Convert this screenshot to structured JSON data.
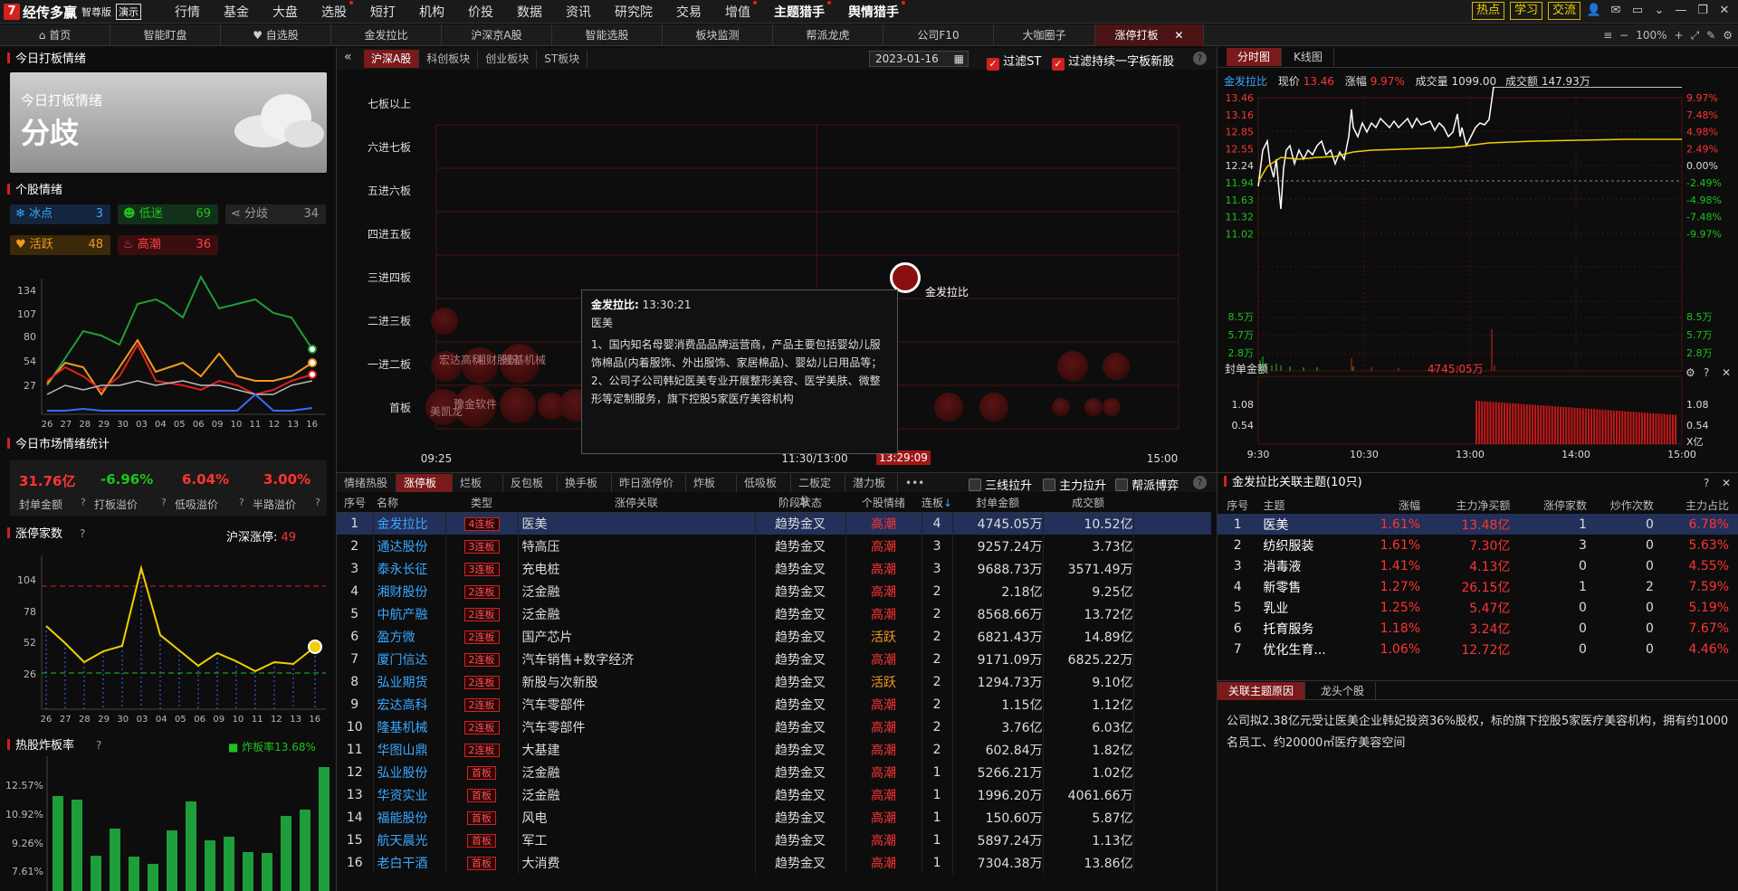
{
  "app": {
    "name": "经传多赢",
    "edition": "智尊版",
    "demo": "演示",
    "menus": [
      "行情",
      "基金",
      "大盘",
      "选股",
      "短打",
      "机构",
      "价投",
      "数据",
      "资讯",
      "研究院",
      "交易",
      "增值",
      "主题猎手",
      "舆情猎手"
    ],
    "right_tags": [
      "热点",
      "学习",
      "交流"
    ],
    "zoom": "100%"
  },
  "tabs": [
    "首页",
    "智能盯盘",
    "自选股",
    "金发拉比",
    "沪深京A股",
    "智能选股",
    "板块监测",
    "帮派龙虎",
    "公司F10",
    "大咖圈子",
    "涨停打板"
  ],
  "left": {
    "title": "今日打板情绪",
    "card_title": "今日打板情绪",
    "card_value": "分歧",
    "mood_title": "个股情绪",
    "moods": [
      {
        "label": "冰点",
        "value": "3"
      },
      {
        "label": "低迷",
        "value": "69"
      },
      {
        "label": "分歧",
        "value": "34"
      },
      {
        "label": "活跃",
        "value": "48"
      },
      {
        "label": "高潮",
        "value": "36"
      }
    ],
    "mood_chart": {
      "yticks": [
        "134",
        "107",
        "80",
        "54",
        "27"
      ],
      "xticks": [
        "26",
        "27",
        "28",
        "29",
        "30",
        "03",
        "04",
        "05",
        "06",
        "09",
        "10",
        "11",
        "12",
        "13",
        "16"
      ]
    },
    "stats_title": "今日市场情绪统计",
    "stats": [
      {
        "value": "31.76亿",
        "label": "封单金额"
      },
      {
        "value": "-6.96%",
        "label": "打板溢价"
      },
      {
        "value": "6.04%",
        "label": "低吸溢价"
      },
      {
        "value": "3.00%",
        "label": "半路溢价"
      }
    ],
    "limit_title": "涨停家数",
    "limit_label": "沪深涨停:",
    "limit_value": "49",
    "limit_chart": {
      "yticks": [
        "104",
        "78",
        "52",
        "26"
      ],
      "xticks": [
        "26",
        "27",
        "28",
        "29",
        "30",
        "03",
        "04",
        "05",
        "06",
        "09",
        "10",
        "11",
        "12",
        "13",
        "16"
      ]
    },
    "burst_title": "热股炸板率",
    "burst_label": "炸板率13.68%",
    "burst_yticks": [
      "12.57%",
      "10.92%",
      "9.26%",
      "7.61%"
    ]
  },
  "mid": {
    "markets": [
      "沪深A股",
      "科创板块",
      "创业板块",
      "ST板块"
    ],
    "date": "2023-01-16",
    "filter1": "过滤ST",
    "filter2": "过滤持续一字板新股",
    "levels": [
      "七板以上",
      "六进七板",
      "五进六板",
      "四进五板",
      "三进四板",
      "二进三板",
      "一进二板",
      "首板"
    ],
    "times": [
      "09:25",
      "11:30/13:00",
      "13:29:09",
      "15:00"
    ],
    "bubble_label": "金发拉比",
    "bubble_texts": [
      "宏达高科",
      "湘财股份",
      "隆基机械",
      "美凯龙",
      "豫金软件"
    ],
    "tooltip": {
      "name": "金发拉比:",
      "time": "13:30:21",
      "theme": "医美",
      "line1": "1、国内知名母婴消费品品牌运营商，产品主要包括婴幼儿服饰棉品(内着服饰、外出服饰、家居棉品)、婴幼儿日用品等；",
      "line2": "2、公司子公司韩妃医美专业开展整形美容、医学美肤、微整形等定制服务，旗下控股5家医疗美容机构"
    },
    "subtabs": [
      "情绪热股",
      "涨停板",
      "烂板",
      "反包板",
      "换手板",
      "昨日涨停价",
      "炸板",
      "低吸板",
      "二板定龙",
      "潜力板"
    ],
    "opt1": "三线拉升",
    "opt2": "主力拉升",
    "opt3": "帮派博弈",
    "columns": [
      "序号",
      "名称",
      "类型",
      "涨停关联",
      "阶段状态",
      "个股情绪",
      "连板",
      "封单金额",
      "成交额"
    ],
    "rows": [
      [
        "1",
        "金发拉比",
        "4连板",
        "医美",
        "趋势金叉",
        "高潮",
        "4",
        "4745.05万",
        "10.52亿"
      ],
      [
        "2",
        "通达股份",
        "3连板",
        "特高压",
        "趋势金叉",
        "高潮",
        "3",
        "9257.24万",
        "3.73亿"
      ],
      [
        "3",
        "泰永长征",
        "3连板",
        "充电桩",
        "趋势金叉",
        "高潮",
        "3",
        "9688.73万",
        "3571.49万"
      ],
      [
        "4",
        "湘财股份",
        "2连板",
        "泛金融",
        "趋势金叉",
        "高潮",
        "2",
        "2.18亿",
        "9.25亿"
      ],
      [
        "5",
        "中航产融",
        "2连板",
        "泛金融",
        "趋势金叉",
        "高潮",
        "2",
        "8568.66万",
        "13.72亿"
      ],
      [
        "6",
        "盈方微",
        "2连板",
        "国产芯片",
        "趋势金叉",
        "活跃",
        "2",
        "6821.43万",
        "14.89亿"
      ],
      [
        "7",
        "厦门信达",
        "2连板",
        "汽车销售+数字经济",
        "趋势金叉",
        "高潮",
        "2",
        "9171.09万",
        "6825.22万"
      ],
      [
        "8",
        "弘业期货",
        "2连板",
        "新股与次新股",
        "趋势金叉",
        "活跃",
        "2",
        "1294.73万",
        "9.10亿"
      ],
      [
        "9",
        "宏达高科",
        "2连板",
        "汽车零部件",
        "趋势金叉",
        "高潮",
        "2",
        "1.15亿",
        "1.12亿"
      ],
      [
        "10",
        "隆基机械",
        "2连板",
        "汽车零部件",
        "趋势金叉",
        "高潮",
        "2",
        "3.76亿",
        "6.03亿"
      ],
      [
        "11",
        "华图山鼎",
        "2连板",
        "大基建",
        "趋势金叉",
        "高潮",
        "2",
        "602.84万",
        "1.82亿"
      ],
      [
        "12",
        "弘业股份",
        "首板",
        "泛金融",
        "趋势金叉",
        "高潮",
        "1",
        "5266.21万",
        "1.02亿"
      ],
      [
        "13",
        "华资实业",
        "首板",
        "泛金融",
        "趋势金叉",
        "高潮",
        "1",
        "1996.20万",
        "4061.66万"
      ],
      [
        "14",
        "福能股份",
        "首板",
        "风电",
        "趋势金叉",
        "高潮",
        "1",
        "150.60万",
        "5.87亿"
      ],
      [
        "15",
        "航天晨光",
        "首板",
        "军工",
        "趋势金叉",
        "高潮",
        "1",
        "5897.24万",
        "1.13亿"
      ],
      [
        "16",
        "老白干酒",
        "首板",
        "大消费",
        "趋势金叉",
        "高潮",
        "1",
        "7304.38万",
        "13.86亿"
      ]
    ]
  },
  "right": {
    "tabs": [
      "分时图",
      "K线图"
    ],
    "info": {
      "name": "金发拉比",
      "price_label": "现价",
      "price": "13.46",
      "chg_label": "涨幅",
      "chg": "9.97%",
      "vol_label": "成交量",
      "vol": "1099.00",
      "amt_label": "成交额",
      "amt": "147.93万"
    },
    "price_ticks": [
      "13.46",
      "13.16",
      "12.85",
      "12.55",
      "12.24",
      "11.94",
      "11.63",
      "11.32",
      "11.02"
    ],
    "pct_ticks": [
      "9.97%",
      "7.48%",
      "4.98%",
      "2.49%",
      "0.00%",
      "-2.49%",
      "-4.98%",
      "-7.48%",
      "-9.97%"
    ],
    "vol_ticks": [
      "8.5万",
      "5.7万",
      "2.8万"
    ],
    "seal_label": "封单金额",
    "seal_value": "4745.05万",
    "seal_ticks": [
      "1.08",
      "0.54"
    ],
    "seal_unit": "X亿",
    "time_ticks": [
      "9:30",
      "10:30",
      "13:00",
      "14:00",
      "15:00"
    ],
    "theme_title": "金发拉比关联主题(10只)",
    "theme_cols": [
      "序号",
      "主题",
      "涨幅",
      "主力净买额",
      "涨停家数",
      "炒作次数",
      "主力占比"
    ],
    "themes": [
      [
        "1",
        "医美",
        "1.61%",
        "13.48亿",
        "1",
        "0",
        "6.78%"
      ],
      [
        "2",
        "纺织服装",
        "1.61%",
        "7.30亿",
        "3",
        "0",
        "5.63%"
      ],
      [
        "3",
        "消毒液",
        "1.41%",
        "4.13亿",
        "0",
        "0",
        "4.55%"
      ],
      [
        "4",
        "新零售",
        "1.27%",
        "26.15亿",
        "1",
        "2",
        "7.59%"
      ],
      [
        "5",
        "乳业",
        "1.25%",
        "5.47亿",
        "0",
        "0",
        "5.19%"
      ],
      [
        "6",
        "托育服务",
        "1.18%",
        "3.24亿",
        "0",
        "0",
        "7.67%"
      ],
      [
        "7",
        "优化生育...",
        "1.06%",
        "12.72亿",
        "0",
        "0",
        "4.46%"
      ]
    ],
    "reason_tabs": [
      "关联主题原因",
      "龙头个股"
    ],
    "reason": "公司拟2.38亿元受让医美企业韩妃投资36%股权，标的旗下控股5家医疗美容机构，拥有约1000名员工、约20000㎡医疗美容空间"
  },
  "colors": {
    "accent": "#d42020",
    "up": "#ff3333",
    "down": "#1ec41e",
    "link": "#3aa7ff"
  }
}
